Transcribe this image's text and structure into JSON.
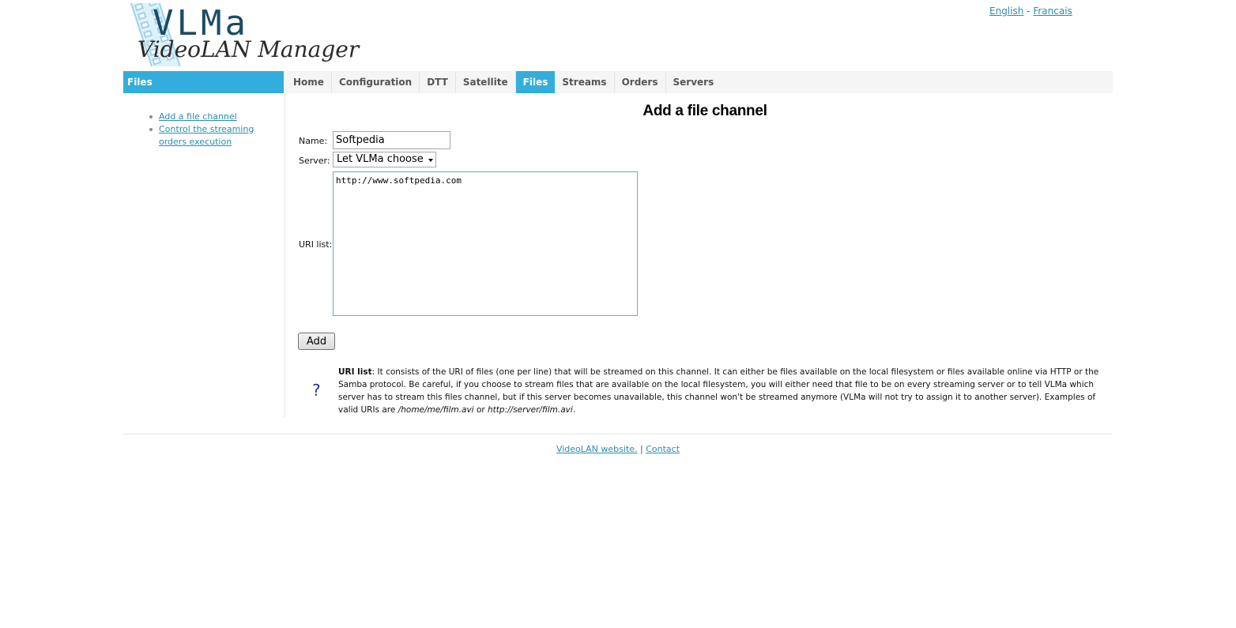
{
  "logo": {
    "title": "VLMa",
    "subtitle": "VideoLAN Manager"
  },
  "language": {
    "english": "English",
    "separator": "-",
    "french": "Francais"
  },
  "section": {
    "title": "Files"
  },
  "nav": {
    "tabs": [
      {
        "label": "Home",
        "active": false
      },
      {
        "label": "Configuration",
        "active": false
      },
      {
        "label": "DTT",
        "active": false
      },
      {
        "label": "Satellite",
        "active": false
      },
      {
        "label": "Files",
        "active": true
      },
      {
        "label": "Streams",
        "active": false
      },
      {
        "label": "Orders",
        "active": false
      },
      {
        "label": "Servers",
        "active": false
      }
    ]
  },
  "sidebar": {
    "items": [
      {
        "label": "Add a file channel"
      },
      {
        "label": "Control the streaming orders execution"
      }
    ]
  },
  "form": {
    "title": "Add a file channel",
    "name_label": "Name:",
    "name_value": "Softpedia",
    "server_label": "Server:",
    "server_value": "Let VLMa choose",
    "uri_label": "URI list:",
    "uri_value": "http://www.softpedia.com",
    "add_button": "Add"
  },
  "help": {
    "icon": "?",
    "term": "URI list",
    "text_1": ": It consists of the URI of files (one per line) that will be streamed on this channel. It can either be files available on the local filesystem or files available online via HTTP or the Samba protocol. Be careful, if you choose to stream files that are available on the local filesystem, you will either need that file to be on every streaming server or to tell VLMa which server has to stream this files channel, but if this server becomes unavailable, this channel won't be streamed anymore (VLMa will not try to assign it to another server). Examples of valid URIs are ",
    "example_1": "/home/me/film.avi",
    "or_text": " or ",
    "example_2": "http://server/film.avi",
    "end": "."
  },
  "footer": {
    "website": "VideoLAN website.",
    "separator": "|",
    "contact": "Contact"
  },
  "colors": {
    "accent": "#33aedc",
    "link": "#2a8db0",
    "logo_text": "#1d4b63"
  }
}
